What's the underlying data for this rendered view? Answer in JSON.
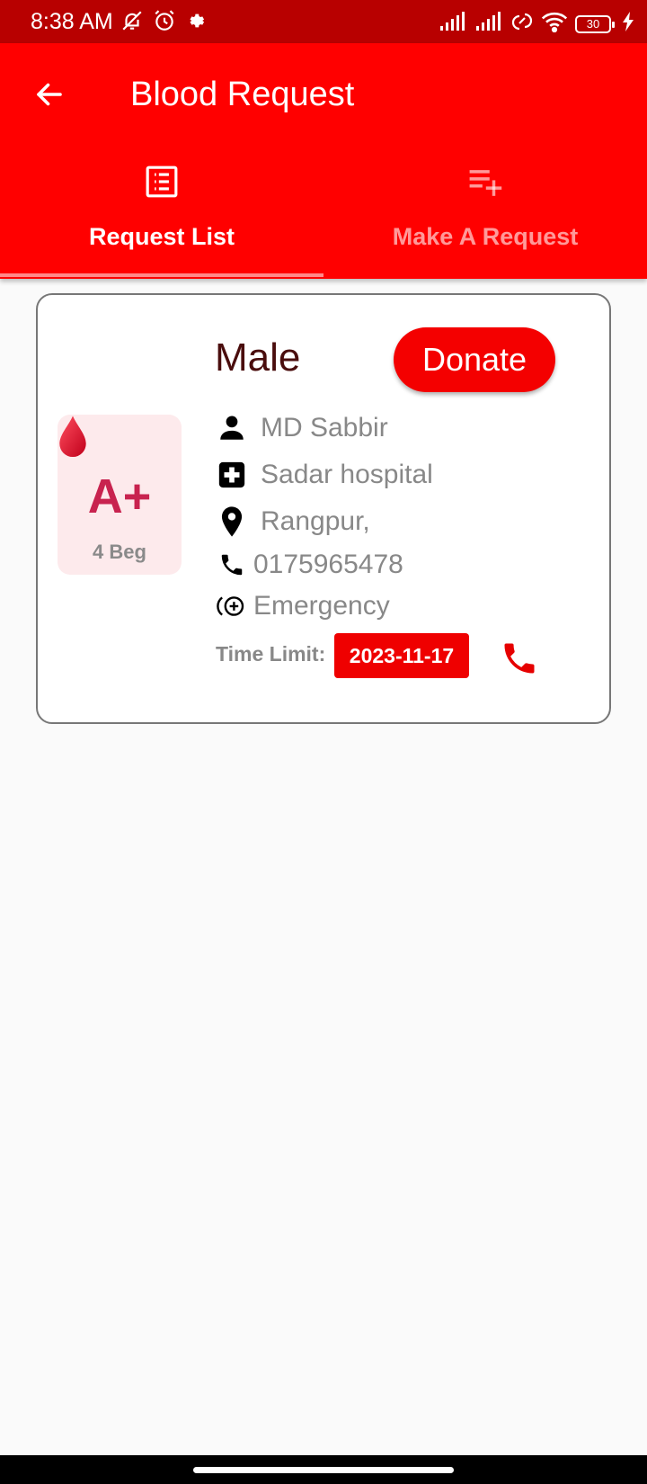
{
  "status_bar": {
    "time": "8:38 AM",
    "battery": "30",
    "icons_left": [
      "mute-icon",
      "alarm-icon",
      "settings-icon"
    ],
    "icons_right": [
      "signal-icon",
      "signal-icon",
      "data-icon",
      "wifi-icon",
      "battery-icon",
      "charging-icon"
    ]
  },
  "appbar": {
    "title": "Blood Request",
    "color": "#ff0000"
  },
  "tabs": [
    {
      "label": "Request List",
      "icon": "list-icon",
      "selected": true
    },
    {
      "label": "Make A Request",
      "icon": "playlist-add-icon",
      "selected": false
    }
  ],
  "request_card": {
    "gender": "Male",
    "donate_label": "Donate",
    "blood_group": "A+",
    "bags": "4 Beg",
    "name": "MD Sabbir",
    "hospital": "Sadar hospital",
    "location": "Rangpur,",
    "phone": "0175965478",
    "urgency": "Emergency",
    "time_limit_label": "Time Limit:",
    "time_limit_date": "2023-11-17"
  },
  "colors": {
    "accent": "#ff0000",
    "status_bar": "#b80000",
    "blood_group_text": "#c8234f"
  }
}
